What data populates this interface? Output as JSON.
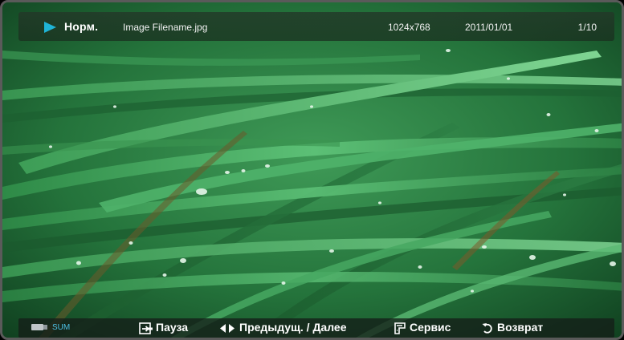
{
  "info_bar": {
    "mode": "Норм.",
    "filename": "Image Filename.jpg",
    "resolution": "1024x768",
    "date": "2011/01/01",
    "page_count": "1/10",
    "play_icon": "play-icon",
    "accent_color": "#1fb4d6"
  },
  "photo": {
    "subject_icon": "grass-photo"
  },
  "help_bar": {
    "source_label": "SUM",
    "source_icon": "usb-icon",
    "pause_label": "Пауза",
    "pause_icon": "enter-icon",
    "nav_label": "Предыдущ. / Далее",
    "nav_icon": "left-right-icon",
    "tools_label": "Сервис",
    "tools_icon": "tools-icon",
    "return_label": "Возврат",
    "return_icon": "return-icon",
    "source_color": "#4ec0e4"
  }
}
